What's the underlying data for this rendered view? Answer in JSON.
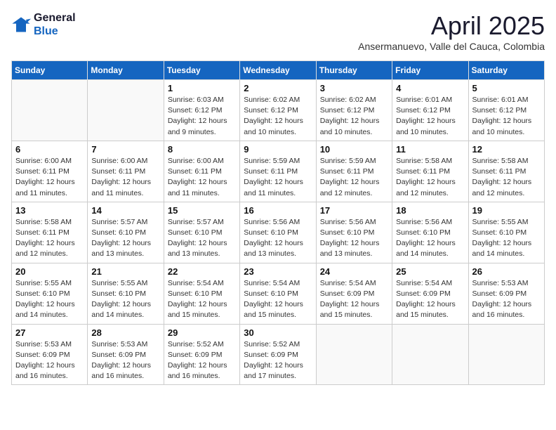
{
  "header": {
    "logo_line1": "General",
    "logo_line2": "Blue",
    "month": "April 2025",
    "location": "Ansermanuevo, Valle del Cauca, Colombia"
  },
  "weekdays": [
    "Sunday",
    "Monday",
    "Tuesday",
    "Wednesday",
    "Thursday",
    "Friday",
    "Saturday"
  ],
  "weeks": [
    [
      {
        "day": "",
        "info": ""
      },
      {
        "day": "",
        "info": ""
      },
      {
        "day": "1",
        "info": "Sunrise: 6:03 AM\nSunset: 6:12 PM\nDaylight: 12 hours\nand 9 minutes."
      },
      {
        "day": "2",
        "info": "Sunrise: 6:02 AM\nSunset: 6:12 PM\nDaylight: 12 hours\nand 10 minutes."
      },
      {
        "day": "3",
        "info": "Sunrise: 6:02 AM\nSunset: 6:12 PM\nDaylight: 12 hours\nand 10 minutes."
      },
      {
        "day": "4",
        "info": "Sunrise: 6:01 AM\nSunset: 6:12 PM\nDaylight: 12 hours\nand 10 minutes."
      },
      {
        "day": "5",
        "info": "Sunrise: 6:01 AM\nSunset: 6:12 PM\nDaylight: 12 hours\nand 10 minutes."
      }
    ],
    [
      {
        "day": "6",
        "info": "Sunrise: 6:00 AM\nSunset: 6:11 PM\nDaylight: 12 hours\nand 11 minutes."
      },
      {
        "day": "7",
        "info": "Sunrise: 6:00 AM\nSunset: 6:11 PM\nDaylight: 12 hours\nand 11 minutes."
      },
      {
        "day": "8",
        "info": "Sunrise: 6:00 AM\nSunset: 6:11 PM\nDaylight: 12 hours\nand 11 minutes."
      },
      {
        "day": "9",
        "info": "Sunrise: 5:59 AM\nSunset: 6:11 PM\nDaylight: 12 hours\nand 11 minutes."
      },
      {
        "day": "10",
        "info": "Sunrise: 5:59 AM\nSunset: 6:11 PM\nDaylight: 12 hours\nand 12 minutes."
      },
      {
        "day": "11",
        "info": "Sunrise: 5:58 AM\nSunset: 6:11 PM\nDaylight: 12 hours\nand 12 minutes."
      },
      {
        "day": "12",
        "info": "Sunrise: 5:58 AM\nSunset: 6:11 PM\nDaylight: 12 hours\nand 12 minutes."
      }
    ],
    [
      {
        "day": "13",
        "info": "Sunrise: 5:58 AM\nSunset: 6:11 PM\nDaylight: 12 hours\nand 12 minutes."
      },
      {
        "day": "14",
        "info": "Sunrise: 5:57 AM\nSunset: 6:10 PM\nDaylight: 12 hours\nand 13 minutes."
      },
      {
        "day": "15",
        "info": "Sunrise: 5:57 AM\nSunset: 6:10 PM\nDaylight: 12 hours\nand 13 minutes."
      },
      {
        "day": "16",
        "info": "Sunrise: 5:56 AM\nSunset: 6:10 PM\nDaylight: 12 hours\nand 13 minutes."
      },
      {
        "day": "17",
        "info": "Sunrise: 5:56 AM\nSunset: 6:10 PM\nDaylight: 12 hours\nand 13 minutes."
      },
      {
        "day": "18",
        "info": "Sunrise: 5:56 AM\nSunset: 6:10 PM\nDaylight: 12 hours\nand 14 minutes."
      },
      {
        "day": "19",
        "info": "Sunrise: 5:55 AM\nSunset: 6:10 PM\nDaylight: 12 hours\nand 14 minutes."
      }
    ],
    [
      {
        "day": "20",
        "info": "Sunrise: 5:55 AM\nSunset: 6:10 PM\nDaylight: 12 hours\nand 14 minutes."
      },
      {
        "day": "21",
        "info": "Sunrise: 5:55 AM\nSunset: 6:10 PM\nDaylight: 12 hours\nand 14 minutes."
      },
      {
        "day": "22",
        "info": "Sunrise: 5:54 AM\nSunset: 6:10 PM\nDaylight: 12 hours\nand 15 minutes."
      },
      {
        "day": "23",
        "info": "Sunrise: 5:54 AM\nSunset: 6:10 PM\nDaylight: 12 hours\nand 15 minutes."
      },
      {
        "day": "24",
        "info": "Sunrise: 5:54 AM\nSunset: 6:09 PM\nDaylight: 12 hours\nand 15 minutes."
      },
      {
        "day": "25",
        "info": "Sunrise: 5:54 AM\nSunset: 6:09 PM\nDaylight: 12 hours\nand 15 minutes."
      },
      {
        "day": "26",
        "info": "Sunrise: 5:53 AM\nSunset: 6:09 PM\nDaylight: 12 hours\nand 16 minutes."
      }
    ],
    [
      {
        "day": "27",
        "info": "Sunrise: 5:53 AM\nSunset: 6:09 PM\nDaylight: 12 hours\nand 16 minutes."
      },
      {
        "day": "28",
        "info": "Sunrise: 5:53 AM\nSunset: 6:09 PM\nDaylight: 12 hours\nand 16 minutes."
      },
      {
        "day": "29",
        "info": "Sunrise: 5:52 AM\nSunset: 6:09 PM\nDaylight: 12 hours\nand 16 minutes."
      },
      {
        "day": "30",
        "info": "Sunrise: 5:52 AM\nSunset: 6:09 PM\nDaylight: 12 hours\nand 17 minutes."
      },
      {
        "day": "",
        "info": ""
      },
      {
        "day": "",
        "info": ""
      },
      {
        "day": "",
        "info": ""
      }
    ]
  ]
}
